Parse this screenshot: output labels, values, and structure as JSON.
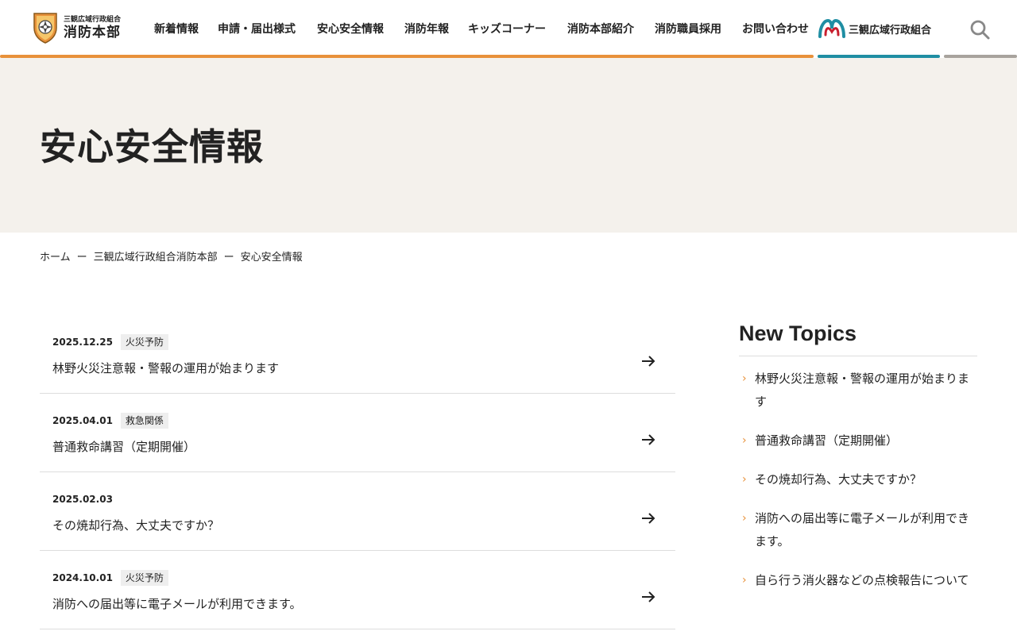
{
  "header": {
    "logo_small": "三観広域行政組合",
    "logo_big": "消防本部",
    "nav": [
      {
        "label": "新着情報"
      },
      {
        "label": "申請・届出様式"
      },
      {
        "label": "安心安全情報"
      },
      {
        "label": "消防年報"
      },
      {
        "label": "キッズコーナー"
      },
      {
        "label": "消防本部紹介"
      },
      {
        "label": "消防職員採用"
      },
      {
        "label": "お問い合わせ"
      }
    ],
    "union_label": "三観広域行政組合",
    "search_icon": "search-icon"
  },
  "hero": {
    "title": "安心安全情報"
  },
  "breadcrumb": {
    "items": [
      "ホーム",
      "三観広域行政組合消防本部",
      "安心安全情報"
    ],
    "separator": "ー"
  },
  "articles": [
    {
      "date": "2025.12.25",
      "tag": "火災予防",
      "title": "林野火災注意報・警報の運用が始まります"
    },
    {
      "date": "2025.04.01",
      "tag": "救急関係",
      "title": "普通救命講習（定期開催）"
    },
    {
      "date": "2025.02.03",
      "tag": "",
      "title": "その焼却行為、大丈夫ですか？"
    },
    {
      "date": "2024.10.01",
      "tag": "火災予防",
      "title": "消防への届出等に電子メールが利用できます。"
    }
  ],
  "sidebar": {
    "title": "New Topics",
    "items": [
      {
        "label": "林野火災注意報・警報の運用が始まります"
      },
      {
        "label": "普通救命講習（定期開催）"
      },
      {
        "label": "その焼却行為、大丈夫ですか？"
      },
      {
        "label": "消防への届出等に電子メールが利用できます。"
      },
      {
        "label": "自ら行う消火器などの点検報告について"
      }
    ]
  },
  "colors": {
    "accent_orange": "#e8913a",
    "accent_teal": "#1f8ea3",
    "hero_bg": "#f4f1ec"
  }
}
